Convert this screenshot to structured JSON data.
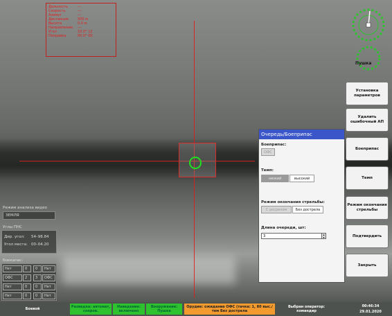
{
  "red_info": {
    "rows": [
      {
        "label": "Дальность",
        "value": "---"
      },
      {
        "label": "Скорость",
        "value": "---"
      },
      {
        "label": "Азимут",
        "value": "---"
      },
      {
        "label": "Дистанция",
        "value": "500 м"
      },
      {
        "label": "Высота",
        "value": "0.0 м"
      },
      {
        "label": "Направление",
        "value": "---"
      },
      {
        "label": "Угол",
        "value": "10.0° 12"
      },
      {
        "label": "Поправка",
        "value": "00.0° 00"
      }
    ]
  },
  "compass": {
    "label": "Пушка"
  },
  "side_buttons": [
    {
      "label": "Установка параметров"
    },
    {
      "label": "Удалить ошибочный АП"
    },
    {
      "label": "Боеприпас"
    },
    {
      "label": "Темп"
    },
    {
      "label": "Режим окончания стрельбы"
    },
    {
      "label": "Подтвердить"
    },
    {
      "label": "Закрыть"
    }
  ],
  "dialog": {
    "title": "Очередь/Боеприпас",
    "ammo_label": "Боеприпас:",
    "ammo_value": "ОФС",
    "rate_label": "Темп:",
    "rate_options": [
      "низкий",
      "высокий"
    ],
    "end_mode_label": "Режим окончания стрельбы:",
    "end_mode_options": [
      "С досрелом",
      "Без дострела"
    ],
    "burst_label": "Длина очереди, шт:",
    "burst_value": "3"
  },
  "analysis_panel": {
    "title": "Режим анализа видео",
    "value": "ЗЕМЛЯ"
  },
  "pns_panel": {
    "title": "Углы ПНС",
    "rows": [
      {
        "label": "Дир. угол:",
        "value": "54–98.84"
      },
      {
        "label": "Угол места:",
        "value": "00–04.20"
      }
    ]
  },
  "ammo_panel": {
    "title": "Боекапас:",
    "left": [
      {
        "name": "Нет",
        "count": "0"
      },
      {
        "name": "ОФС",
        "count": "2"
      },
      {
        "name": "Нет",
        "count": "0"
      },
      {
        "name": "Нет",
        "count": "0"
      }
    ],
    "right": [
      {
        "name": "Нет",
        "count": "0"
      },
      {
        "name": "ОФС",
        "count": "3"
      },
      {
        "name": "Нет",
        "count": "0"
      },
      {
        "name": "Нет",
        "count": "0"
      }
    ]
  },
  "status": {
    "mode": "Боевой",
    "green1": "Разведка: автомат, сопров.",
    "green2": "Наведение: включено",
    "green3": "Вооружение: Пушка",
    "orange": "Орудие: ожидание ОФС (тачка: 1, 80 выс./тем Без дострела",
    "operator": "Выбран оператор: командир",
    "time": "00:46:34",
    "date": "29.01.2020"
  },
  "colors": {
    "accent": "#3a56c8",
    "green": "#2fc22f",
    "orange": "#f29a2e",
    "reticle": "#e02020"
  }
}
